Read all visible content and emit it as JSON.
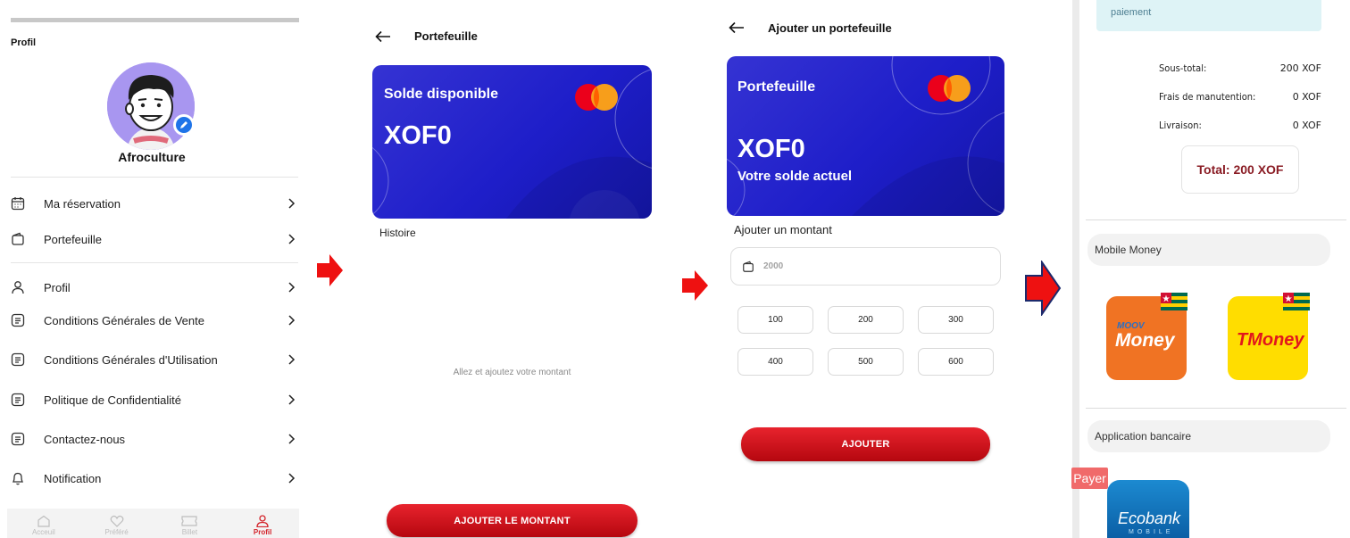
{
  "profile_screen": {
    "title": "Profil",
    "user_name": "Afroculture",
    "menu": [
      {
        "label": "Ma réservation",
        "icon": "calendar-icon"
      },
      {
        "label": "Portefeuille",
        "icon": "wallet-icon"
      },
      {
        "label": "Profil",
        "icon": "user-icon"
      },
      {
        "label": "Conditions Générales de Vente",
        "icon": "document-icon"
      },
      {
        "label": "Conditions Générales d'Utilisation",
        "icon": "document-icon"
      },
      {
        "label": "Politique de Confidentialité",
        "icon": "document-icon"
      },
      {
        "label": "Contactez-nous",
        "icon": "document-icon"
      },
      {
        "label": "Notification",
        "icon": "bell-icon"
      }
    ],
    "bottom_nav": [
      {
        "label": "Acceuil",
        "icon": "home-icon",
        "active": false
      },
      {
        "label": "Préféré",
        "icon": "heart-icon",
        "active": false
      },
      {
        "label": "Billet",
        "icon": "ticket-icon",
        "active": false
      },
      {
        "label": "Profil",
        "icon": "user-icon",
        "active": true
      }
    ]
  },
  "wallet_screen": {
    "header": "Portefeuille",
    "card_title": "Solde disponible",
    "card_amount": "XOF0",
    "history_label": "Histoire",
    "empty_message": "Allez et ajoutez votre montant",
    "button_label": "AJOUTER LE MONTANT"
  },
  "add_wallet_screen": {
    "header": "Ajouter un portefeuille",
    "card_title": "Portefeuille",
    "card_amount": "XOF0",
    "card_subtitle": "Votre solde actuel",
    "amount_label": "Ajouter un montant",
    "amount_placeholder": "2000",
    "amount_chips": [
      "100",
      "200",
      "300",
      "400",
      "500",
      "600"
    ],
    "button_label": "AJOUTER"
  },
  "payment_screen": {
    "info_text": "paiement",
    "summary": [
      {
        "label": "Sous-total:",
        "value": "200 XOF"
      },
      {
        "label": "Frais de manutention:",
        "value": "0 XOF"
      },
      {
        "label": "Livraison:",
        "value": "0 XOF"
      }
    ],
    "total": "Total:  200 XOF",
    "mobile_money_label": "Mobile Money",
    "providers": [
      {
        "name": "Moov Money",
        "logo_top": "MOOV",
        "logo_bottom": "Money",
        "color": "#f07323"
      },
      {
        "name": "TMoney",
        "logo": "TMoney",
        "color": "#ffdd00"
      }
    ],
    "bank_app_label": "Application bancaire",
    "bank": {
      "name": "Ecobank",
      "sub": "MOBILE"
    },
    "pay_tag": "Payer"
  },
  "colors": {
    "brand_red": "#d3232a",
    "card_blue": "#2222c8",
    "total_red": "#8a1c24"
  }
}
